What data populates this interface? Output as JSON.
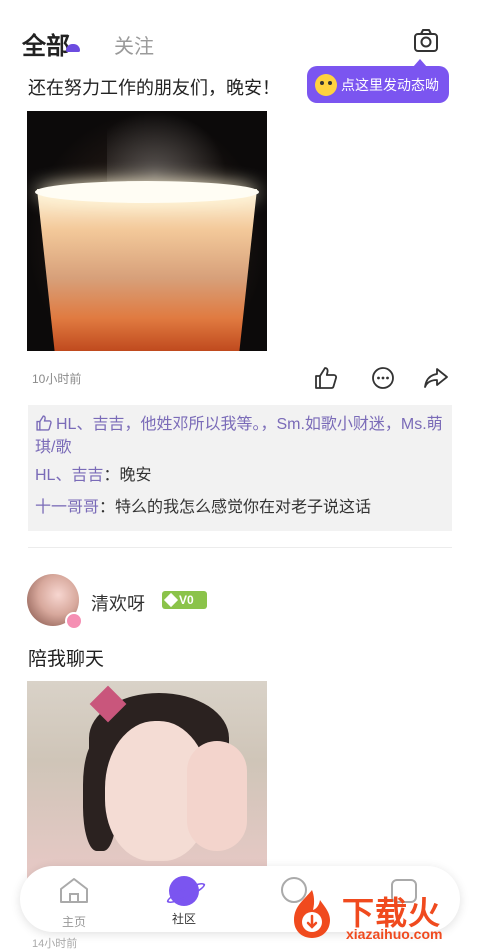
{
  "header": {
    "tab_all": "全部",
    "tab_follow": "关注",
    "camera_icon": "camera-icon",
    "tooltip": "点这里发动态呦"
  },
  "post1": {
    "text": "还在努力工作的朋友们，晚安！",
    "time": "10小时前",
    "likes": "HL、吉吉，他姓邓所以我等。，Sm.如歌小财迷，Ms.萌琪/歌",
    "comments": [
      {
        "author": "HL、吉吉",
        "text": "晚安"
      },
      {
        "author": "十一哥哥",
        "text": "特么的我怎么感觉你在对老子说这话"
      }
    ]
  },
  "post2": {
    "username": "清欢呀",
    "vip": "V0",
    "text": "陪我聊天",
    "time": "14小时前"
  },
  "nav": {
    "home": "主页",
    "community": "社区"
  },
  "watermark": {
    "main": "下载火",
    "sub": "xiazaihuo.com"
  },
  "colors": {
    "accent": "#7b55f0",
    "comment_author": "#7a6bb8",
    "vip": "#8bc34a",
    "watermark": "#f04a1e"
  }
}
